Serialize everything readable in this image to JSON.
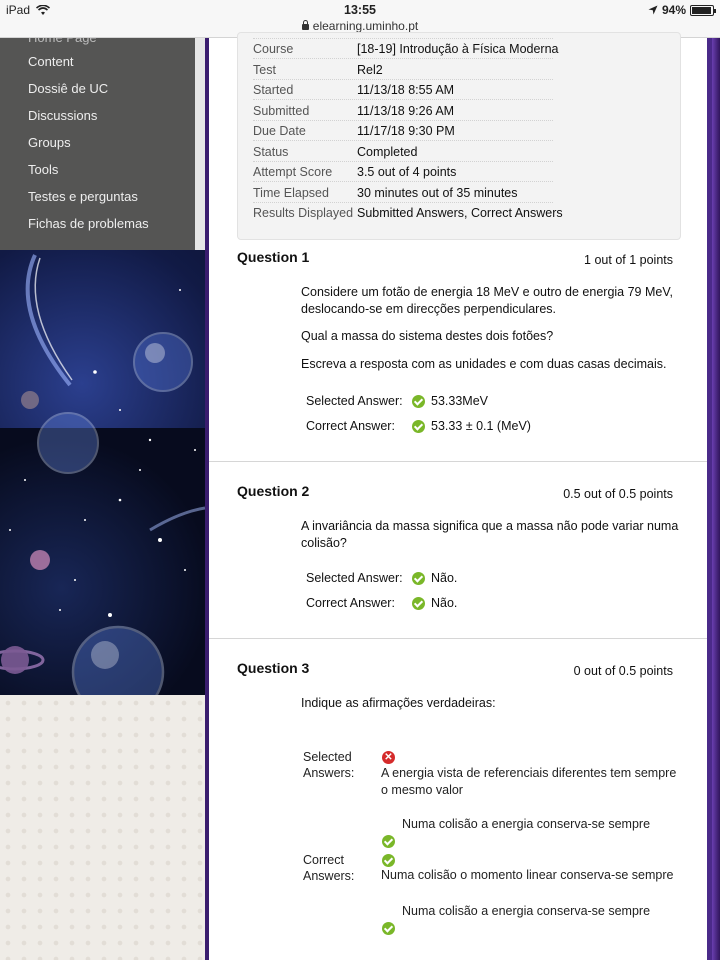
{
  "status_bar": {
    "device": "iPad",
    "time": "13:55",
    "url": "elearning.uminho.pt",
    "battery": "94%",
    "battery_level": 0.94
  },
  "sidebar": {
    "cut_item": "Home Page",
    "items": [
      {
        "label": "Content"
      },
      {
        "label": "Dossiê de UC"
      },
      {
        "label": "Discussions"
      },
      {
        "label": "Groups"
      },
      {
        "label": "Tools"
      },
      {
        "label": "Testes e perguntas"
      },
      {
        "label": "Fichas de problemas"
      }
    ]
  },
  "summary": {
    "rows": [
      {
        "label": "Course",
        "value": "[18-19] Introdução à Física Moderna"
      },
      {
        "label": "Test",
        "value": "Rel2"
      },
      {
        "label": "Started",
        "value": "11/13/18 8:55 AM"
      },
      {
        "label": "Submitted",
        "value": "11/13/18 9:26 AM"
      },
      {
        "label": "Due Date",
        "value": "11/17/18 9:30 PM"
      },
      {
        "label": "Status",
        "value": "Completed"
      },
      {
        "label": "Attempt Score",
        "value": "3.5 out of 4 points"
      },
      {
        "label": "Time Elapsed",
        "value": "30 minutes out of 35 minutes"
      },
      {
        "label": "Results Displayed",
        "value": "Submitted Answers, Correct Answers"
      }
    ]
  },
  "questions": [
    {
      "title": "Question 1",
      "points": "1 out of 1 points",
      "paragraphs": [
        "Considere um fotão de energia 18 MeV e outro de energia 79 MeV, deslocando-se em direcções perpendiculares.",
        "Qual a massa do sistema destes dois fotões?",
        "Escreva a resposta com as unidades e com duas casas decimais."
      ],
      "selected_label": "Selected Answer:",
      "selected": "53.33MeV",
      "correct_label": "Correct Answer:",
      "correct": "53.33 ± 0.1 (MeV)"
    },
    {
      "title": "Question 2",
      "points": "0.5 out of 0.5 points",
      "paragraphs": [
        "A invariância da massa significa que a massa não pode variar numa colisão?"
      ],
      "selected_label": "Selected Answer:",
      "selected": "Não.",
      "correct_label": "Correct Answer:",
      "correct": "Não."
    },
    {
      "title": "Question 3",
      "points": "0 out of 0.5 points",
      "paragraphs": [
        "Indique as afirmações verdadeiras:"
      ],
      "selected_label_1": "Selected",
      "selected_label_2": "Answers:",
      "selected": [
        "A energia vista de referenciais diferentes tem sempre o mesmo valor",
        "Numa colisão a energia conserva-se sempre"
      ],
      "correct_label_1": "Correct",
      "correct_label_2": "Answers:",
      "correct": [
        "Numa colisão o momento linear conserva-se sempre",
        "Numa colisão a energia conserva-se sempre"
      ]
    }
  ],
  "colors": {
    "correct": "#7ab729",
    "incorrect": "#d52b2b",
    "sidebar": "#555554",
    "frame": "#4b2a8a"
  }
}
